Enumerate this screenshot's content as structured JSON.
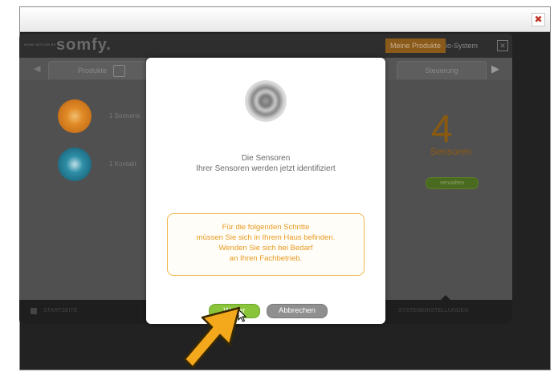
{
  "window": {
    "close_glyph": "✖"
  },
  "app": {
    "brand_sub": "HOME MOTION BY",
    "brand": "somfy.",
    "nav": {
      "products": "Meine Produkte",
      "system": "io-System",
      "close": "✕"
    },
    "tabs": {
      "products": "Produkte",
      "control": "Steuerung"
    },
    "devices": [
      {
        "label": "1 Sonnens",
        "icon": "sun-sensor-icon",
        "color": "#e08a26"
      },
      {
        "label": "1 Kontakt",
        "icon": "contact-sensor-icon",
        "color": "#2d8ea6"
      }
    ],
    "sensor_count": "4",
    "sensor_label": "Sensoren",
    "manage_button": "verwalten",
    "bottom_left": "STARTSEITE",
    "bottom_right": "SYSTEMEINSTELLUNGEN"
  },
  "modal": {
    "title": "Die Sensoren",
    "subtitle": "Ihrer Sensoren werden jetzt identifiziert",
    "notice_lines": [
      "Für die folgenden Schritte",
      "müssen Sie sich in Ihrem Haus befinden.",
      "Wenden Sie sich bei Bedarf",
      "an Ihren Fachbetrieb."
    ],
    "next_button": "Weiter",
    "cancel_button": "Abbrechen"
  },
  "colors": {
    "accent_orange": "#e89a20",
    "next_green": "#8ac43a",
    "cancel_gray": "#8f8f8f"
  }
}
